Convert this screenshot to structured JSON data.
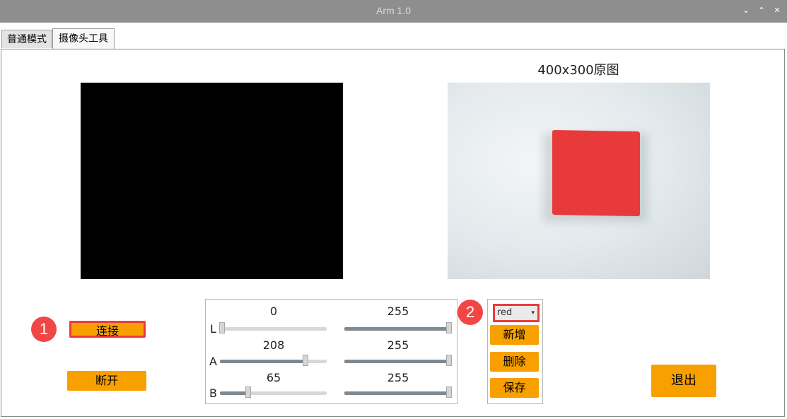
{
  "window": {
    "title": "Arm 1.0",
    "controls": [
      "⌄",
      "⌃",
      "✕"
    ]
  },
  "tabs": [
    {
      "label": "普通模式",
      "active": false
    },
    {
      "label": "摄像头工具",
      "active": true
    }
  ],
  "image_caption": "400x300原图",
  "buttons": {
    "connect": "连接",
    "disconnect": "断开",
    "exit": "退出",
    "add": "新增",
    "delete": "删除",
    "save": "保存"
  },
  "markers": {
    "one": "1",
    "two": "2"
  },
  "sliders": {
    "rows": [
      {
        "label": "L",
        "min_value": "0",
        "max_value": "255"
      },
      {
        "label": "A",
        "min_value": "208",
        "max_value": "255"
      },
      {
        "label": "B",
        "min_value": "65",
        "max_value": "255"
      }
    ]
  },
  "color_select": {
    "value": "red",
    "arrow": "▾"
  },
  "colors": {
    "button": "#f8a000",
    "highlight": "#ee3a3a",
    "title_bar": "#8e8e8e"
  }
}
